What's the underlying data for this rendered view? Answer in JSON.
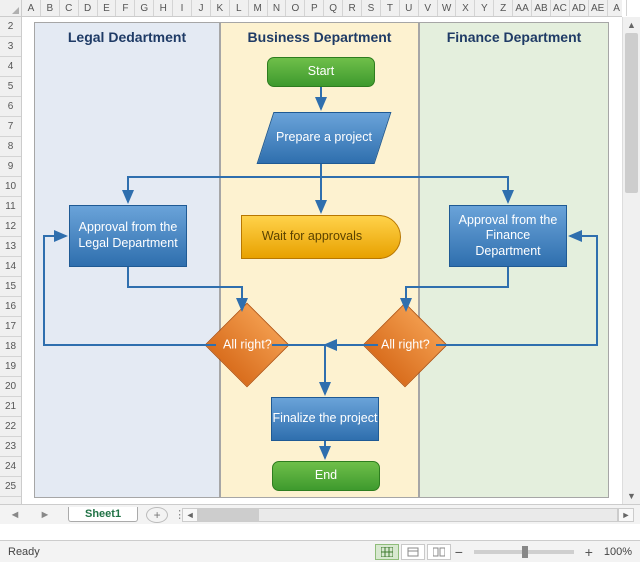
{
  "columns": [
    "A",
    "B",
    "C",
    "D",
    "E",
    "F",
    "G",
    "H",
    "I",
    "J",
    "K",
    "L",
    "M",
    "N",
    "O",
    "P",
    "Q",
    "R",
    "S",
    "T",
    "U",
    "V",
    "W",
    "X",
    "Y",
    "Z",
    "AA",
    "AB",
    "AC",
    "AD",
    "AE",
    "A"
  ],
  "rows": [
    "2",
    "3",
    "4",
    "5",
    "6",
    "7",
    "8",
    "9",
    "10",
    "11",
    "12",
    "13",
    "14",
    "15",
    "16",
    "17",
    "18",
    "19",
    "20",
    "21",
    "22",
    "23",
    "24",
    "25"
  ],
  "lanes": {
    "legal": "Legal Dedartment",
    "business": "Business Department",
    "finance": "Finance Department"
  },
  "shapes": {
    "start": "Start",
    "prepare": "Prepare a project",
    "approval_legal": "Approval from the Legal Department",
    "wait": "Wait for approvals",
    "approval_finance": "Approval from the Finance Department",
    "allright_left": "All right?",
    "allright_right": "All right?",
    "finalize": "Finalize the project",
    "end": "End"
  },
  "sheet_tab": "Sheet1",
  "status": {
    "ready": "Ready",
    "zoom": "100%"
  },
  "zoom_minus": "−",
  "zoom_plus": "+",
  "tab_add": "+"
}
